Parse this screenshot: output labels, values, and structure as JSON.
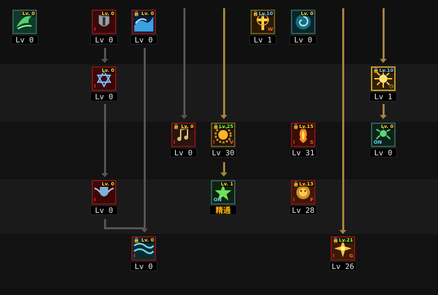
{
  "colors": {
    "band_dark": "#0f0f0f",
    "band_light": "#1c1c1c",
    "link_grey": "#555555",
    "link_gold": "#a5843f",
    "learned_border": "#7a1414"
  },
  "skills": [
    {
      "id": "s1",
      "icon": "green-wing-icon",
      "tag": "Lv. 0",
      "level": "Lv 0"
    },
    {
      "id": "s2",
      "icon": "shield-helm-icon",
      "tag": "Lv. 0",
      "level": "Lv 0"
    },
    {
      "id": "s3",
      "icon": "water-wave-icon",
      "tag": "Lv. 0",
      "level": "Lv 0"
    },
    {
      "id": "s4",
      "icon": "holy-cross-icon",
      "tag": "Lv.10",
      "level": "Lv 1"
    },
    {
      "id": "s5",
      "icon": "spiral-orb-icon",
      "tag": "Lv. 0",
      "level": "Lv 0"
    },
    {
      "id": "s6",
      "icon": "hexagram-icon",
      "tag": "Lv. 0",
      "level": "Lv 0"
    },
    {
      "id": "s7",
      "icon": "golden-burst-icon",
      "tag": "Lv.10",
      "level": "Lv 1"
    },
    {
      "id": "s8",
      "icon": "music-note-icon",
      "tag": "Lv. 0",
      "level": "Lv 0"
    },
    {
      "id": "s9",
      "icon": "sun-gear-icon",
      "tag": "Lv.25",
      "level": "Lv 30"
    },
    {
      "id": "s10",
      "icon": "flame-hand-icon",
      "tag": "Lv.15",
      "level": "Lv 31"
    },
    {
      "id": "s11",
      "icon": "green-spore-icon",
      "tag": "Lv. 0",
      "level": "Lv 0"
    },
    {
      "id": "s12",
      "icon": "winged-shield-icon",
      "tag": "Lv. 0",
      "level": "Lv 0"
    },
    {
      "id": "s13",
      "icon": "green-star-icon",
      "tag": "Lv. 1",
      "level": "精通"
    },
    {
      "id": "s14",
      "icon": "golden-lion-icon",
      "tag": "Lv.13",
      "level": "Lv 28"
    },
    {
      "id": "s15",
      "icon": "teal-wave-icon",
      "tag": "Lv. 0",
      "level": "Lv 0"
    },
    {
      "id": "s16",
      "icon": "golden-spark-icon",
      "tag": "Lv.21",
      "level": "Lv 26"
    }
  ]
}
